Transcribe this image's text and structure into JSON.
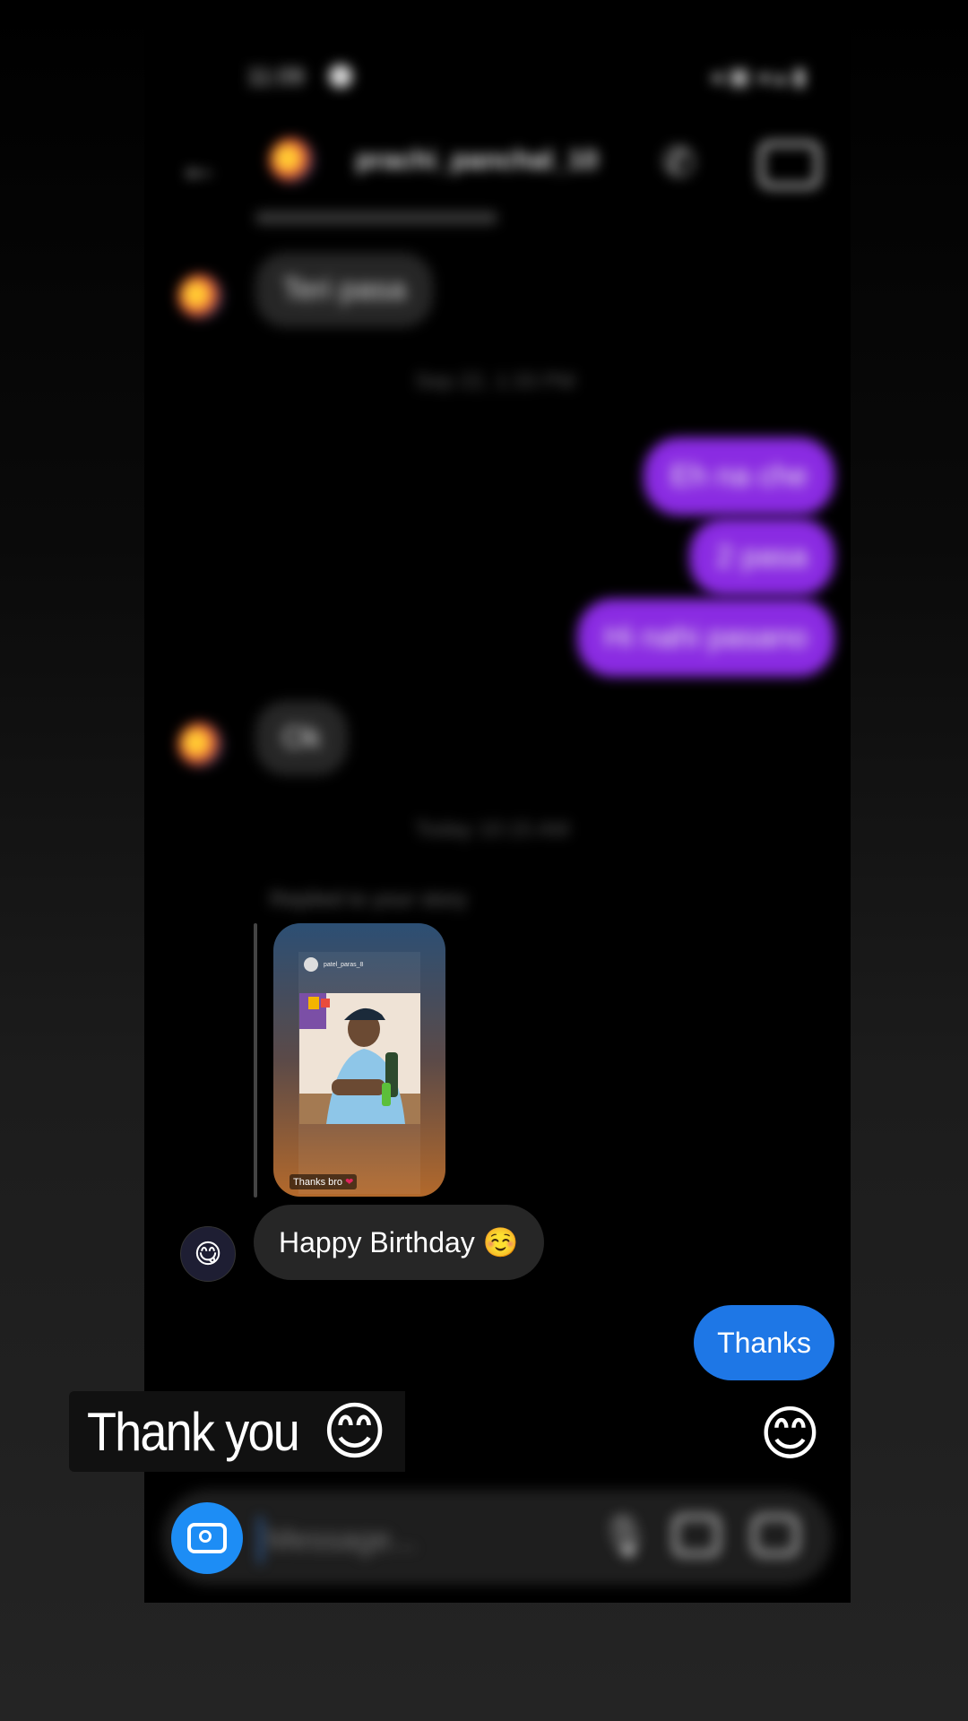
{
  "status_bar": {
    "time": "11:09",
    "icons": "◂ ▣ ◂ ▴ ▮"
  },
  "header": {
    "back_icon": "←",
    "username": "prachi_panchal_10",
    "call_icon": "phone",
    "video_icon": "video"
  },
  "messages": {
    "in_1": "Teri pasa",
    "timestamp_1": "Sep 22, 1:33 PM",
    "out_1": "Eh na che",
    "out_2": "2 pasa",
    "out_3": "Hi nahi pasano",
    "in_2": "Ok",
    "timestamp_2": "Today 10:15 AM",
    "replied_label": "Replied to your story",
    "story_user": "patel_paras_8",
    "story_caption": "Thanks bro",
    "story_heart": "❤",
    "in_3": "Happy Birthday ☺️",
    "out_4": "Thanks",
    "reaction_emoji": "😊"
  },
  "composer": {
    "placeholder": "Message..."
  },
  "overlay": {
    "text": "Thank you",
    "emoji": "😊"
  }
}
